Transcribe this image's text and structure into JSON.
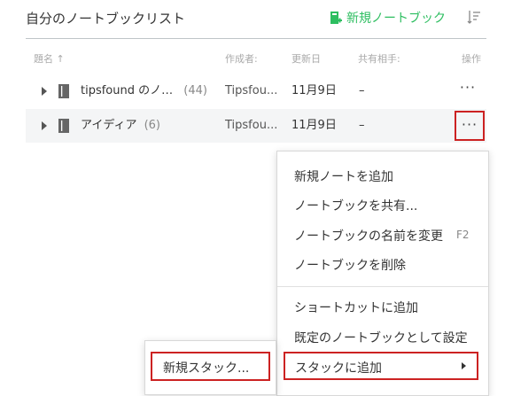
{
  "header": {
    "title": "自分のノートブックリスト",
    "new_notebook_label": "新規ノートブック",
    "accent_color": "#2dbe60"
  },
  "columns": {
    "title": "題名 ↑",
    "author": "作成者:",
    "updated": "更新日",
    "shared": "共有相手:",
    "actions": "操作"
  },
  "rows": [
    {
      "name": "tipsfound のノ…",
      "count": "(44)",
      "author": "Tipsfou...",
      "updated": "11月9日",
      "shared": "–",
      "more": "···"
    },
    {
      "name": "アイディア",
      "count": "(6)",
      "author": "Tipsfou...",
      "updated": "11月9日",
      "shared": "–",
      "more": "···"
    }
  ],
  "context_menu": {
    "items": [
      "新規ノートを追加",
      "ノートブックを共有...",
      "ノートブックの名前を変更",
      "ノートブックを削除",
      "ショートカットに追加",
      "既定のノートブックとして設定",
      "スタックに追加"
    ],
    "rename_shortcut": "F2"
  },
  "submenu": {
    "new_stack": "新規スタック..."
  },
  "highlight_color": "#cc2222"
}
